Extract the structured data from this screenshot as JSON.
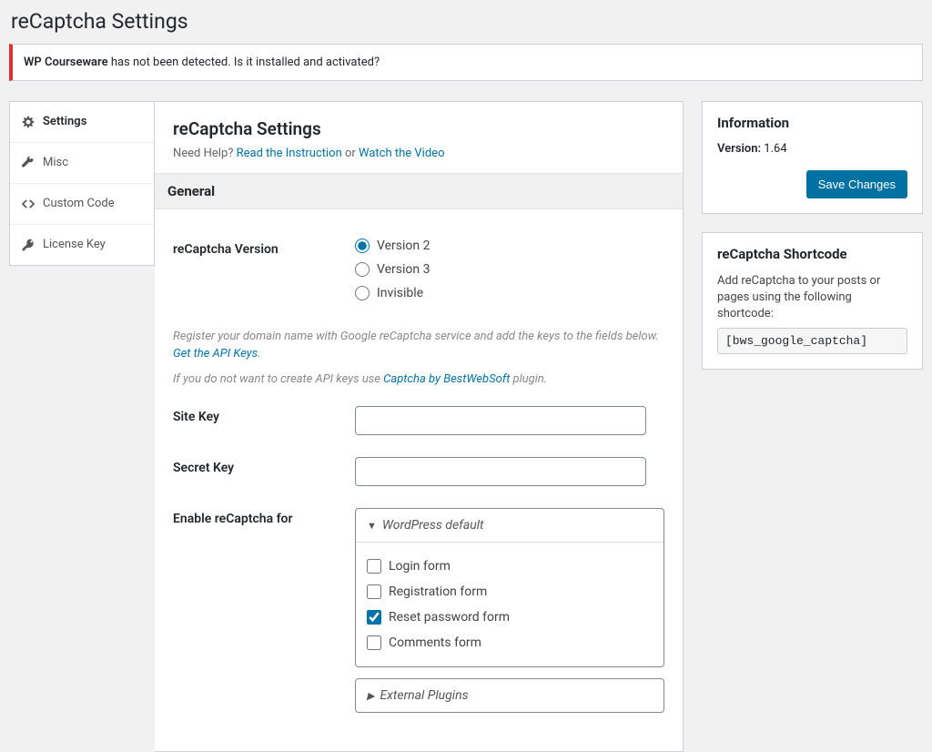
{
  "page": {
    "title": "reCaptcha Settings"
  },
  "notice": {
    "strong": "WP Courseware",
    "rest": " has not been detected. Is it installed and activated?"
  },
  "sidebar": {
    "items": [
      {
        "label": "Settings"
      },
      {
        "label": "Misc"
      },
      {
        "label": "Custom Code"
      },
      {
        "label": "License Key"
      }
    ]
  },
  "panel": {
    "heading": "reCaptcha Settings",
    "help_prefix": "Need Help? ",
    "help_link1": "Read the Instruction",
    "help_or": " or ",
    "help_link2": "Watch the Video",
    "section_general": "General",
    "version_label": "reCaptcha Version",
    "version_options": [
      "Version 2",
      "Version 3",
      "Invisible"
    ],
    "hint1a": "Register your domain name with Google reCaptcha service and add the keys to the fields below. ",
    "hint1b": "Get the API Keys",
    "hint1c": ".",
    "hint2a": "If you do not want to create API keys use ",
    "hint2b": "Captcha by BestWebSoft",
    "hint2c": " plugin.",
    "site_key_label": "Site Key",
    "secret_key_label": "Secret Key",
    "enable_label": "Enable reCaptcha for",
    "acc1_title": "WordPress default",
    "acc1_items": [
      "Login form",
      "Registration form",
      "Reset password form",
      "Comments form"
    ],
    "acc1_checked_index": 2,
    "acc2_title": "External Plugins"
  },
  "info_box": {
    "title": "Information",
    "version_label": "Version:",
    "version_value": "1.64",
    "save_btn": "Save Changes"
  },
  "shortcode_box": {
    "title": "reCaptcha Shortcode",
    "desc": "Add reCaptcha to your posts or pages using the following shortcode:",
    "code": "[bws_google_captcha]"
  }
}
